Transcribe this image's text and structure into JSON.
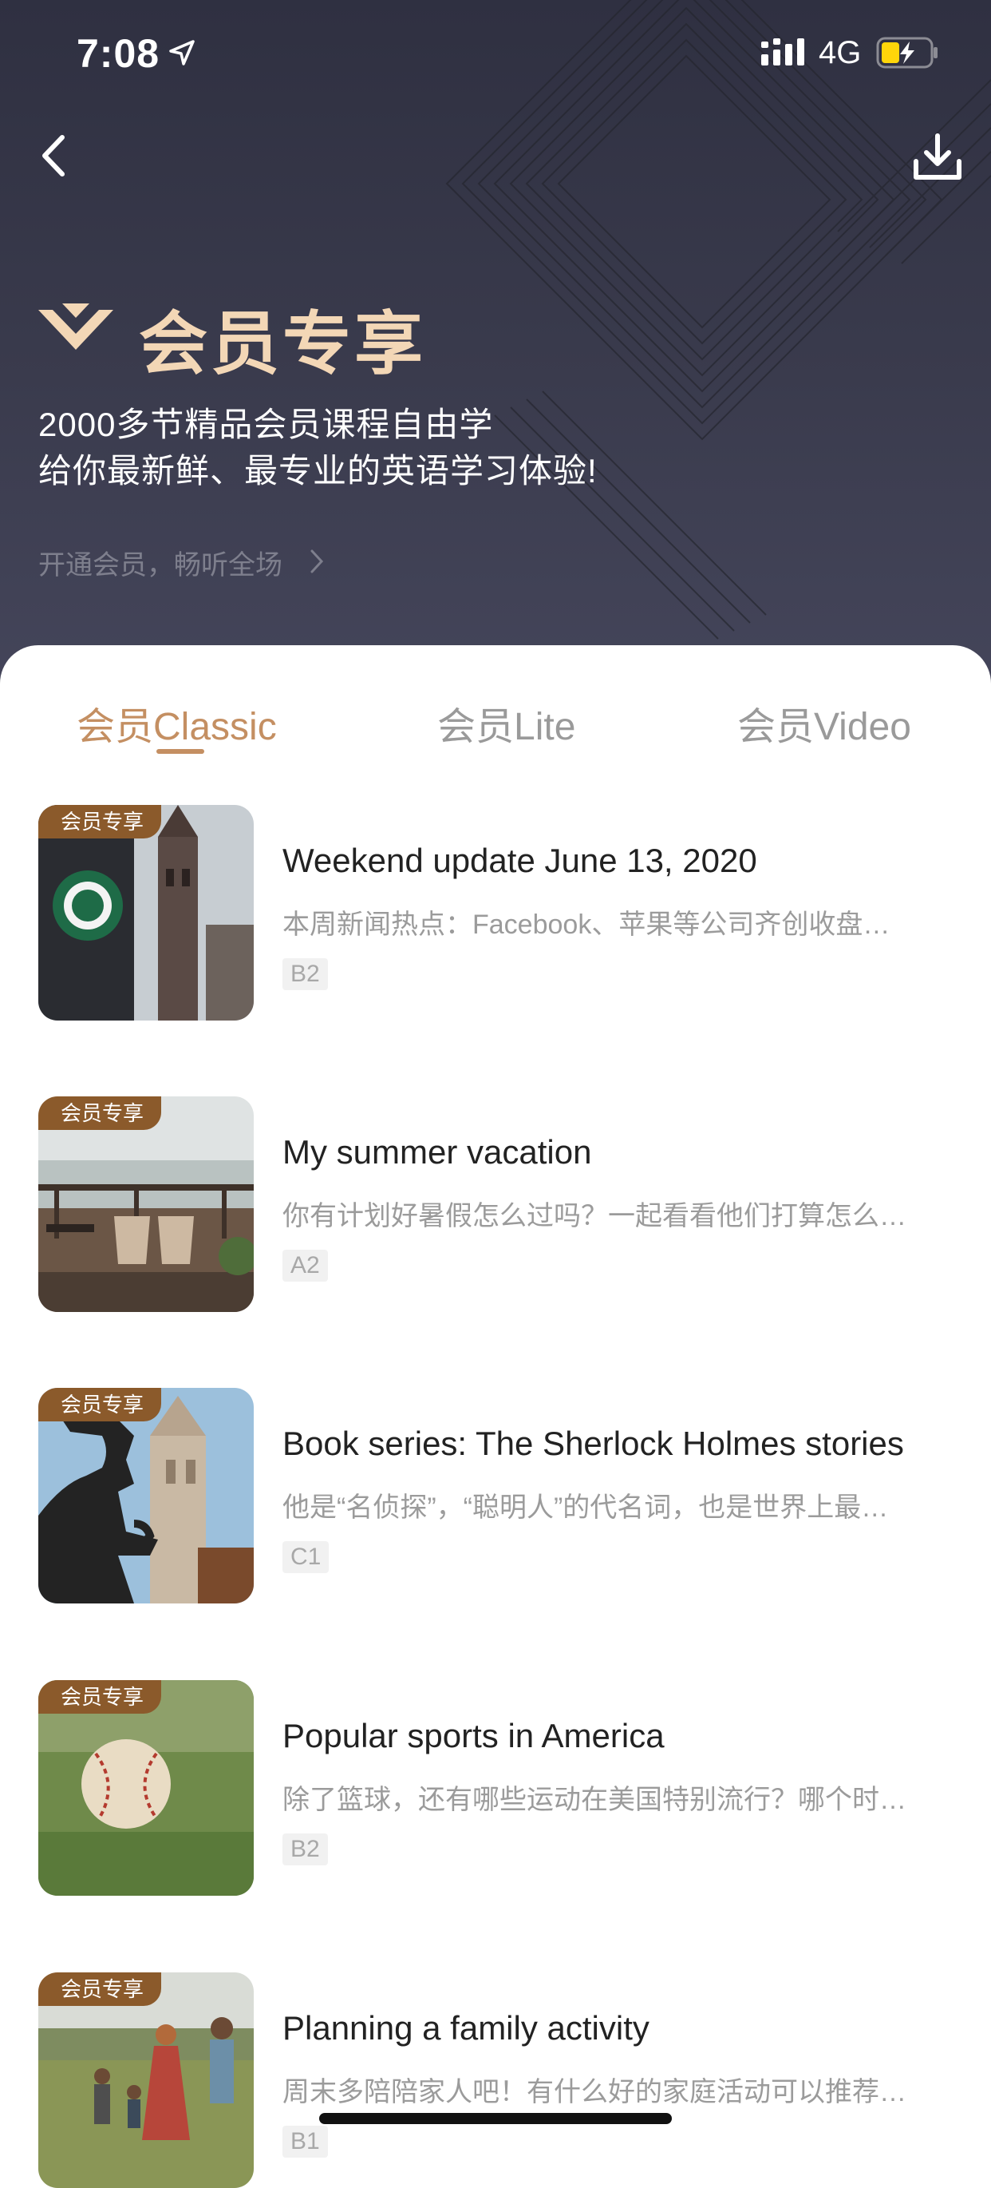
{
  "status_bar": {
    "time": "7:08",
    "network": "4G"
  },
  "header": {
    "title": "会员专享",
    "subtitle_line1": "2000多节精品会员课程自由学",
    "subtitle_line2": "给你最新鲜、最专业的英语学习体验!",
    "cta": "开通会员，畅听全场"
  },
  "tabs": [
    {
      "label": "会员Classic",
      "active": true
    },
    {
      "label": "会员Lite",
      "active": false
    },
    {
      "label": "会员Video",
      "active": false
    }
  ],
  "badge_label": "会员专享",
  "items": [
    {
      "title": "Weekend update June 13, 2020",
      "desc": "本周新闻热点：Facebook、苹果等公司齐创收盘…",
      "level": "B2",
      "image": "starbucks-street-photo"
    },
    {
      "title": "My summer vacation",
      "desc": "你有计划好暑假怎么过吗？一起看看他们打算怎么…",
      "level": "A2",
      "image": "seaside-deck-photo"
    },
    {
      "title": "Book series: The Sherlock Holmes stories",
      "desc": "他是“名侦探”，“聪明人”的代名词，也是世界上最…",
      "level": "C1",
      "image": "sherlock-statue-photo"
    },
    {
      "title": "Popular sports in America",
      "desc": "除了篮球，还有哪些运动在美国特别流行？哪个时…",
      "level": "B2",
      "image": "baseball-grass-photo"
    },
    {
      "title": "Planning a family activity",
      "desc": "周末多陪陪家人吧！有什么好的家庭活动可以推荐…",
      "level": "B1",
      "image": "family-field-photo"
    }
  ],
  "colors": {
    "accent": "#c48f62",
    "header_bg": "#2f3041",
    "title_gold": "#f3d7b6",
    "badge": "#8b5a2b"
  }
}
